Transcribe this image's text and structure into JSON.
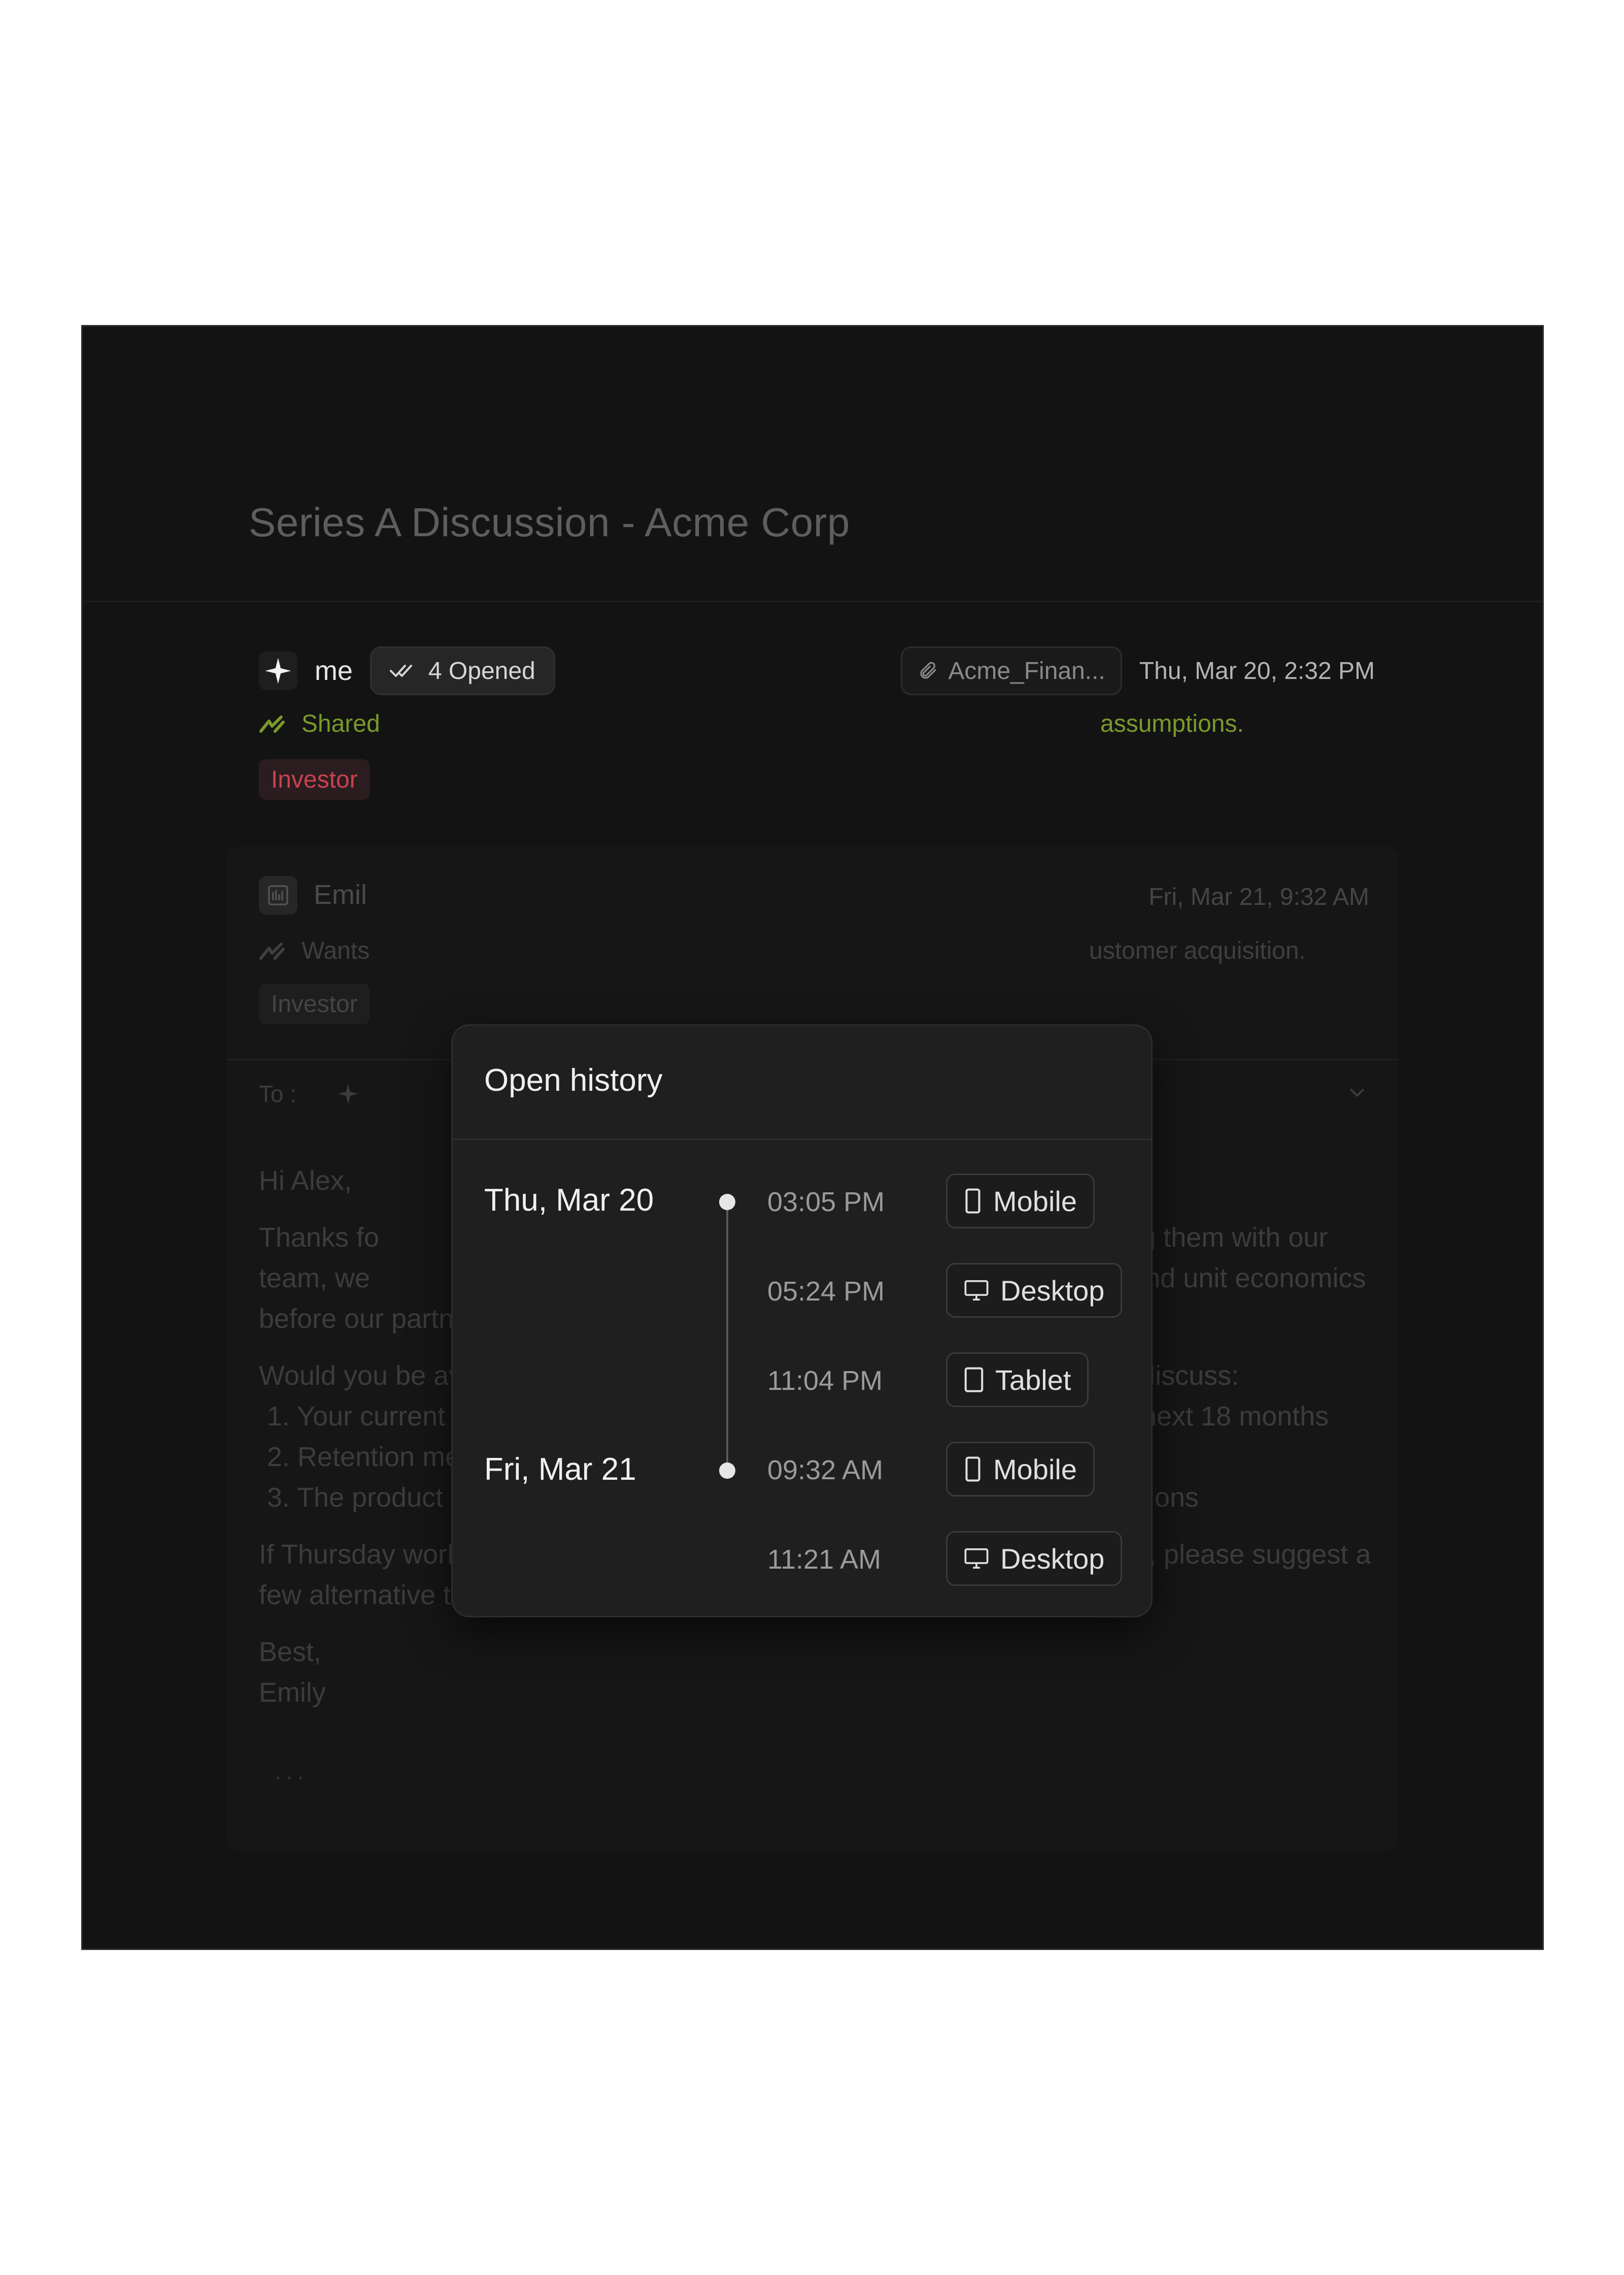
{
  "thread": {
    "title": "Series A Discussion - Acme Corp"
  },
  "message1": {
    "sender": "me",
    "opened_label": "4 Opened",
    "attachment": "Acme_Finan...",
    "date": "Thu, Mar 20, 2:32 PM",
    "summary_start": "Shared",
    "summary_end": "assumptions.",
    "tag": "Investor"
  },
  "message2": {
    "sender": "Emil",
    "date": "Fri, Mar 21, 9:32 AM",
    "summary_start": "Wants",
    "summary_end": "ustomer acquisition.",
    "tag": "Investor",
    "to_label": "To :",
    "greeting": "Hi Alex,",
    "para1_a": "Thanks fo",
    "para1_b": "eviewing them with our",
    "para1_c": "team, we",
    "para1_d": "tegy and unit economics",
    "para1_e": "before our partner meeting next week.",
    "para2": "Would you be available for a call this Thursday at 2 PM PT? We'd like to discuss:",
    "list": [
      "1. Your current CAC by channel and how you see that evolving over the next 18 months",
      "2. Retention metrics, particularly for enterprise customers",
      "3. The product roadmap as it relates to your expansion revenue assumptions"
    ],
    "para3": "If Thursday works, I'll send a calendar invite with Zoom details. Otherwise, please suggest a few alternative times that work for you.",
    "signoff": "Best,",
    "signature": "Emily",
    "dots": "···"
  },
  "popover": {
    "title": "Open history",
    "days": [
      "Thu, Mar 20",
      "Fri, Mar 21"
    ],
    "entries": [
      {
        "time": "03:05 PM",
        "device": "Mobile",
        "icon": "mobile-icon"
      },
      {
        "time": "05:24 PM",
        "device": "Desktop",
        "icon": "desktop-icon"
      },
      {
        "time": "11:04 PM",
        "device": "Tablet",
        "icon": "tablet-icon"
      },
      {
        "time": "09:32 AM",
        "device": "Mobile",
        "icon": "mobile-icon"
      },
      {
        "time": "11:21 AM",
        "device": "Desktop",
        "icon": "desktop-icon"
      }
    ]
  },
  "colors": {
    "background": "#131313",
    "summary_green": "#7a9a2c",
    "tag_red": "#c8424f"
  }
}
